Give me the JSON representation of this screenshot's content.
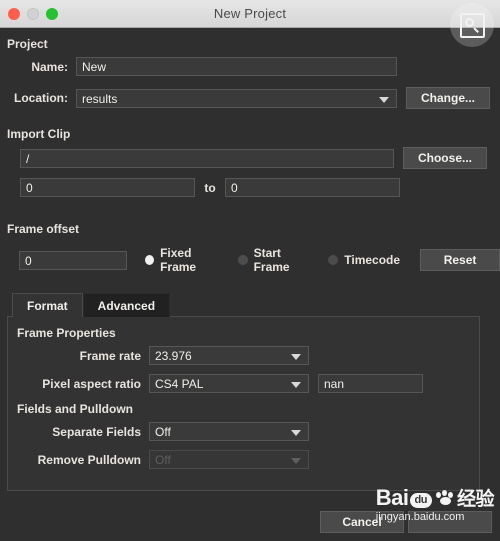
{
  "window": {
    "title": "New Project",
    "controls": [
      "close-red",
      "minimize-gray",
      "zoom-green"
    ],
    "search_badge_icon": "search-zoom-icon"
  },
  "project": {
    "section_label": "Project",
    "name_label": "Name:",
    "name_value": "New",
    "name_placeholder": "",
    "location_label": "Location:",
    "location_value": "results",
    "change_button": "Change..."
  },
  "import_clip": {
    "section_label": "Import Clip",
    "path_value": "/",
    "path_placeholder": "",
    "choose_button": "Choose...",
    "range_from": "0",
    "range_to_label": "to",
    "range_to": "0"
  },
  "frame_offset": {
    "section_label": "Frame offset",
    "offset_value": "0",
    "options": [
      {
        "label": "Fixed Frame",
        "selected": true
      },
      {
        "label": "Start Frame",
        "selected": false
      },
      {
        "label": "Timecode",
        "selected": false
      }
    ],
    "reset_button": "Reset"
  },
  "tabs": [
    {
      "label": "Format",
      "active": true
    },
    {
      "label": "Advanced",
      "active": false
    }
  ],
  "format_tab": {
    "frame_properties_label": "Frame Properties",
    "frame_rate_label": "Frame rate",
    "frame_rate_value": "23.976",
    "pixel_aspect_label": "Pixel aspect ratio",
    "pixel_aspect_value": "CS4 PAL",
    "pixel_aspect_custom": "nan",
    "fields_pulldown_label": "Fields and Pulldown",
    "separate_fields_label": "Separate Fields",
    "separate_fields_value": "Off",
    "remove_pulldown_label": "Remove Pulldown",
    "remove_pulldown_value": "Off"
  },
  "footer": {
    "cancel_button": "Cancel",
    "ok_button": ""
  },
  "watermark": {
    "brand": "Bai",
    "badge": "du",
    "cn": "经验",
    "url": "jingyan.baidu.com"
  },
  "colors": {
    "window_bg": "#2f2f2f",
    "titlebar": "#dcdcdc",
    "field_bg": "#3a3a3a",
    "button_bg": "#4a4a4a",
    "text": "#e8e4dd",
    "accent_red": "#ff5f4a",
    "accent_green": "#22c32e"
  }
}
